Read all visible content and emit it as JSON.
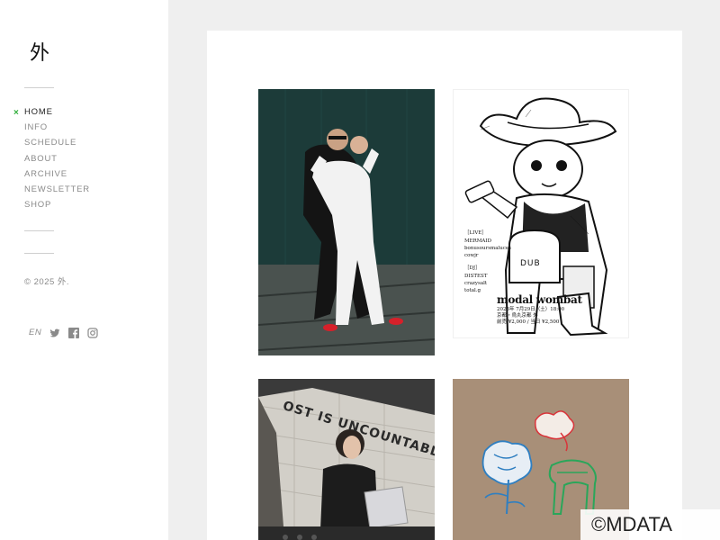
{
  "site": {
    "logo": "外",
    "nav": [
      {
        "label": "HOME",
        "active": true,
        "marker": "×"
      },
      {
        "label": "INFO"
      },
      {
        "label": "SCHEDULE"
      },
      {
        "label": "ABOUT"
      },
      {
        "label": "ARCHIVE"
      },
      {
        "label": "NEWSLETTER"
      },
      {
        "label": "SHOP"
      }
    ],
    "copyright": "© 2025 外.",
    "language": "EN",
    "social_icons": [
      "twitter-icon",
      "facebook-icon",
      "instagram-icon"
    ]
  },
  "colors": {
    "sidebar_bg": "#ffffff",
    "main_bg": "#efefef",
    "accent_marker": "#2fae3a",
    "nav_text": "#8a8a8a"
  },
  "posts": [
    {
      "image": "duo-posing-photo"
    },
    {
      "image": "modal-wombat-flyer",
      "sign_text": "DUB",
      "live_label": "［LIVE］",
      "live_acts": [
        "MERMAID",
        "bonusoursmaluces",
        "cowjr"
      ],
      "dj_label": "［DJ］",
      "dj_acts": [
        "DISTEST",
        "crazysalt",
        "total.g"
      ],
      "title": "modal wombat",
      "date_line": "2025年 7月29日（土）18:00",
      "venue_line": "京都・烏丸京都 外",
      "price_line": "前売 ¥2,000 / 当日 ¥2,500"
    },
    {
      "image": "dj-performance-photo",
      "wall_text": "OST IS UNCOUNTABLE"
    },
    {
      "image": "flower-illustration"
    }
  ],
  "watermark": "©MDATA"
}
